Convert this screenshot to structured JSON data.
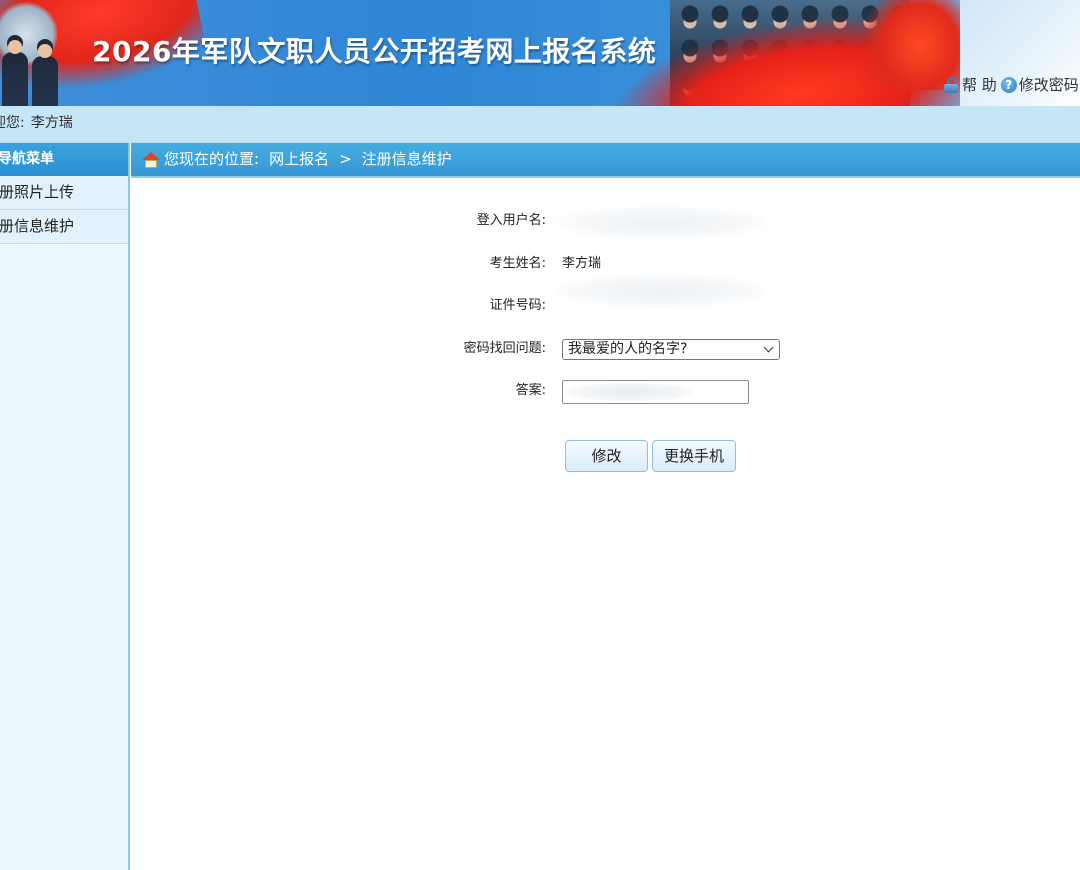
{
  "banner": {
    "title": "2026年军队文职人员公开招考网上报名系统",
    "help_label": "帮 助",
    "change_password_label": "修改密码"
  },
  "welcome": {
    "prefix": "迎您:",
    "user_name": "李方瑞"
  },
  "sidebar": {
    "header": "导航菜单",
    "items": [
      {
        "label": "册照片上传"
      },
      {
        "label": "册信息维护"
      }
    ]
  },
  "breadcrumb": {
    "prefix": "您现在的位置:",
    "level1": "网上报名",
    "separator": ">",
    "level2": "注册信息维护"
  },
  "form": {
    "login_username_label": "登入用户名:",
    "candidate_name_label": "考生姓名:",
    "candidate_name_value": "李方瑞",
    "id_number_label": "证件号码:",
    "security_question_label": "密码找回问题:",
    "security_question_value": "我最爱的人的名字?",
    "answer_label": "答案:",
    "modify_button": "修改",
    "change_phone_button": "更换手机"
  },
  "icons": {
    "help": "lock-icon",
    "change_password": "help-icon",
    "breadcrumb": "home-icon",
    "select": "chevron-down-icon"
  },
  "colors": {
    "banner_blue": "#3a90d8",
    "nav_blue": "#3597d6",
    "welcome_bar": "#c4e6f7",
    "sidebar_bg": "#ebf6fd"
  }
}
